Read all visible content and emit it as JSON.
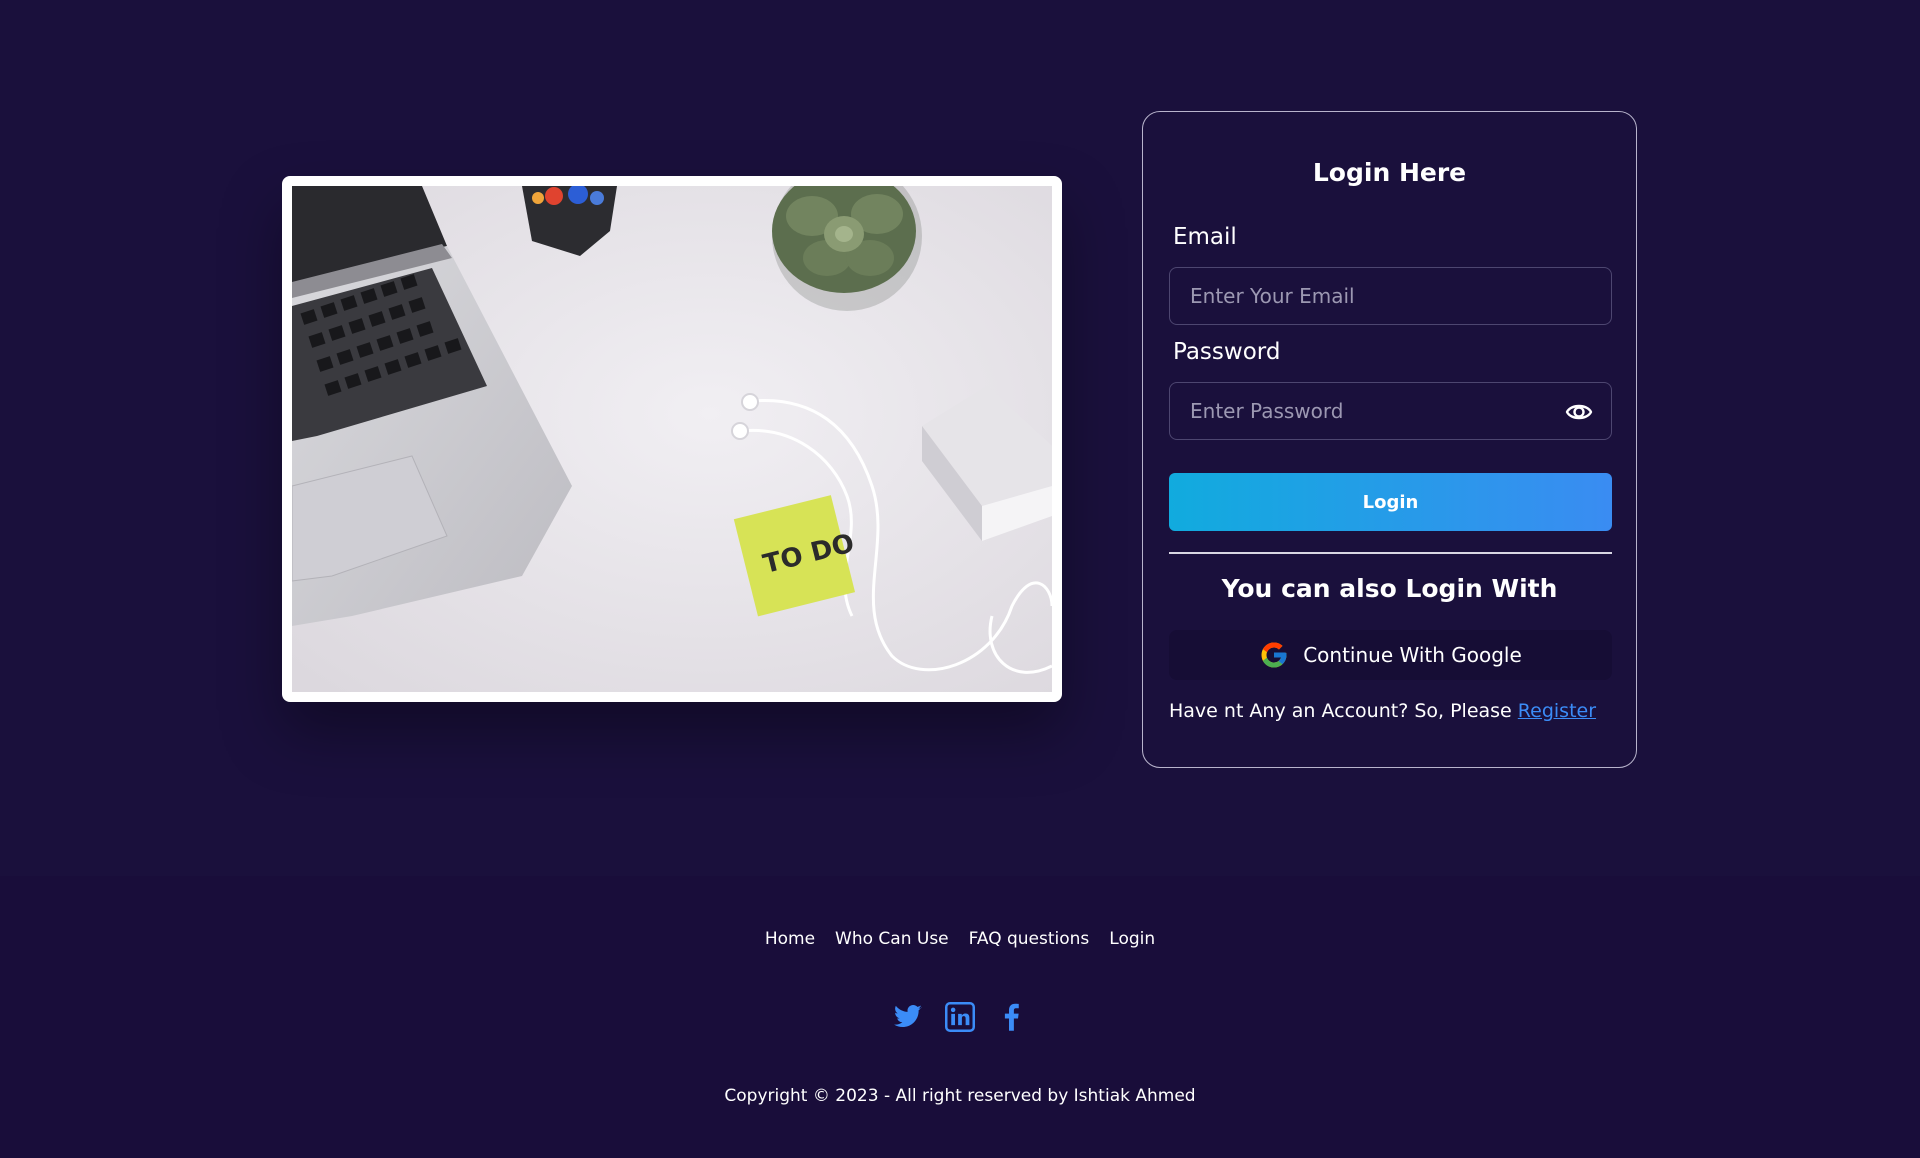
{
  "login_card": {
    "title": "Login Here",
    "email_label": "Email",
    "email_placeholder": "Enter Your Email",
    "email_value": "",
    "password_label": "Password",
    "password_placeholder": "Enter Password",
    "password_value": "",
    "login_button": "Login",
    "alt_login_title": "You can also Login With",
    "google_button": "Continue With Google",
    "register_prompt": "Have nt Any an Account? So, Please ",
    "register_link": "Register"
  },
  "hero_image": {
    "sticky_note_text": "TO DO"
  },
  "footer": {
    "nav": [
      "Home",
      "Who Can Use",
      "FAQ questions",
      "Login"
    ],
    "social_icons": [
      "twitter-icon",
      "linkedin-icon",
      "facebook-icon"
    ],
    "copyright": "Copyright © 2023 - All right reserved by Ishtiak Ahmed"
  },
  "colors": {
    "background": "#1a103c",
    "accent_start": "#11abde",
    "accent_end": "#3a8cf2",
    "link": "#3b8cf7",
    "social_icon": "#3b8cf7"
  }
}
